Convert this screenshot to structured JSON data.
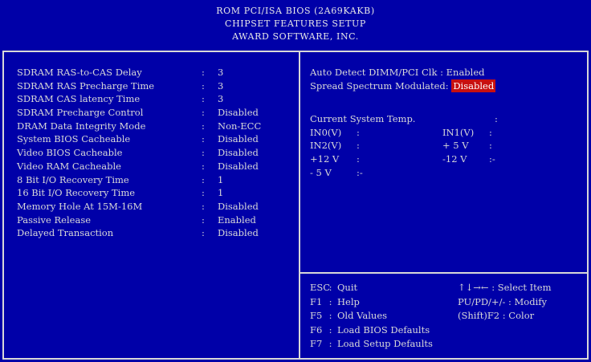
{
  "header": {
    "line1": "ROM PCI/ISA BIOS (2A69KAKB)",
    "line2": "CHIPSET FEATURES SETUP",
    "line3": "AWARD SOFTWARE, INC."
  },
  "left_settings": [
    {
      "label": "SDRAM RAS-to-CAS Delay",
      "value": "3"
    },
    {
      "label": "SDRAM RAS Precharge Time",
      "value": "3"
    },
    {
      "label": "SDRAM CAS latency Time",
      "value": "3"
    },
    {
      "label": "SDRAM Precharge Control",
      "value": "Disabled"
    },
    {
      "label": "DRAM Data Integrity Mode",
      "value": "Non-ECC"
    },
    {
      "label": "System BIOS Cacheable",
      "value": "Disabled"
    },
    {
      "label": "Video  BIOS Cacheable",
      "value": "Disabled"
    },
    {
      "label": "Video RAM Cacheable",
      "value": "Disabled"
    },
    {
      "label": "8 Bit I/O Recovery Time",
      "value": "1"
    },
    {
      "label": "16 Bit I/O Recovery Time",
      "value": "1"
    },
    {
      "label": "Memory Hole At 15M-16M",
      "value": "Disabled"
    },
    {
      "label": "Passive Release",
      "value": "Enabled"
    },
    {
      "label": "Delayed Transaction",
      "value": "Disabled"
    }
  ],
  "right_settings": {
    "auto_detect_label": "Auto Detect DIMM/PCI Clk",
    "auto_detect_value": "Enabled",
    "spread_label": "Spread Spectrum Modulated",
    "spread_value": "Disabled"
  },
  "temperature": {
    "label": "Current System Temp.",
    "rows": [
      {
        "left": "IN0(V)",
        "right": "IN1(V)"
      },
      {
        "left": "IN2(V)",
        "right": "+ 5 V"
      },
      {
        "left": "+12 V",
        "right": "-12 V"
      },
      {
        "left": "- 5 V",
        "right": ""
      }
    ]
  },
  "keys": [
    {
      "key": "ESC",
      "desc": "Quit",
      "hint": "↑↓→← : Select Item"
    },
    {
      "key": "F1",
      "desc": "Help",
      "hint": "PU/PD/+/- : Modify"
    },
    {
      "key": "F5",
      "desc": "Old Values",
      "hint": "(Shift)F2 : Color"
    },
    {
      "key": "F6",
      "desc": "Load BIOS  Defaults",
      "hint": ""
    },
    {
      "key": "F7",
      "desc": "Load Setup Defaults",
      "hint": ""
    }
  ],
  "colors": {
    "background": "#0000a8",
    "text": "#d8d8d8",
    "highlight": "#c81010"
  }
}
